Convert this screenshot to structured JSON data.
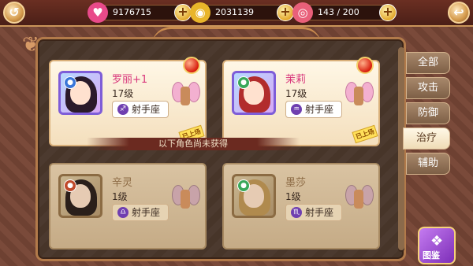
{
  "topbar": {
    "hearts": "9176715",
    "coins": "2031139",
    "stamina": "143 / 200"
  },
  "owned": [
    {
      "name": "罗丽+1",
      "level": "17级",
      "sign": "射手座",
      "stamp": "已上场",
      "zod": "♐"
    },
    {
      "name": "茉莉",
      "level": "17级",
      "sign": "射手座",
      "stamp": "已上场",
      "zod": "♒"
    }
  ],
  "divider": "以下角色尚未获得",
  "locked": [
    {
      "name": "辛灵",
      "level": "1级",
      "sign": "射手座",
      "zod": "♎"
    },
    {
      "name": "墨莎",
      "level": "1级",
      "sign": "射手座",
      "zod": "♏"
    }
  ],
  "tabs": [
    "全部",
    "攻击",
    "防御",
    "治疗",
    "辅助"
  ],
  "active_tab": "治疗",
  "tujian": "图鉴",
  "icons": {
    "back": "back-arrow-icon",
    "close": "swap-icon",
    "heart": "heart-gem-icon",
    "coin": "gold-coin-icon",
    "donut": "donut-icon"
  }
}
